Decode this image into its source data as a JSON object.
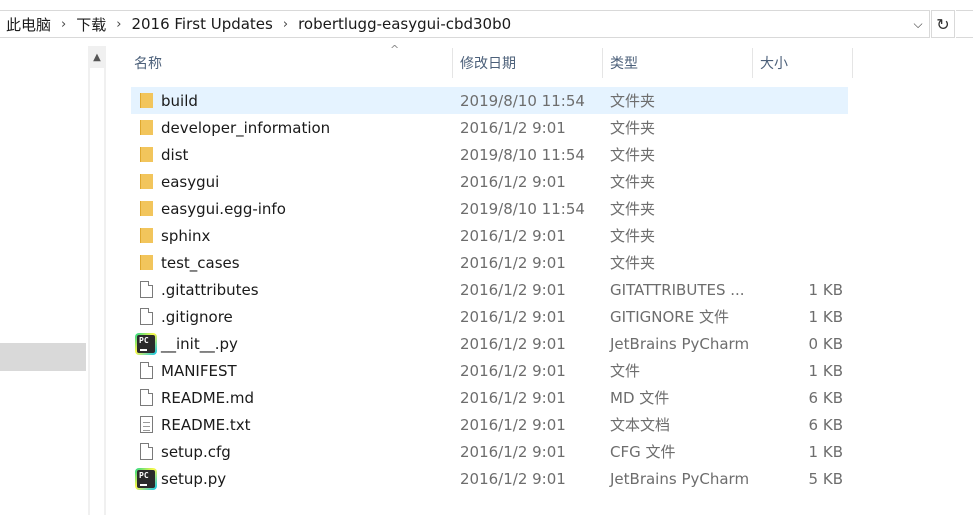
{
  "address": {
    "crumbs": [
      "此电脑",
      "下载",
      "2016 First Updates",
      "robertlugg-easygui-cbd30b0"
    ],
    "separator": "›",
    "dropdown_glyph": "⌵",
    "refresh_glyph": "↻"
  },
  "nav": {
    "scroll_up_glyph": "▲"
  },
  "columns": {
    "name": "名称",
    "date": "修改日期",
    "type": "类型",
    "size": "大小",
    "sort_glyph": "^"
  },
  "files": [
    {
      "name": "build",
      "date": "2019/8/10 11:54",
      "type": "文件夹",
      "size": "",
      "icon": "folder-icon",
      "selected": true
    },
    {
      "name": "developer_information",
      "date": "2016/1/2 9:01",
      "type": "文件夹",
      "size": "",
      "icon": "folder-icon"
    },
    {
      "name": "dist",
      "date": "2019/8/10 11:54",
      "type": "文件夹",
      "size": "",
      "icon": "folder-icon"
    },
    {
      "name": "easygui",
      "date": "2016/1/2 9:01",
      "type": "文件夹",
      "size": "",
      "icon": "folder-icon"
    },
    {
      "name": "easygui.egg-info",
      "date": "2019/8/10 11:54",
      "type": "文件夹",
      "size": "",
      "icon": "folder-icon"
    },
    {
      "name": "sphinx",
      "date": "2016/1/2 9:01",
      "type": "文件夹",
      "size": "",
      "icon": "folder-icon"
    },
    {
      "name": "test_cases",
      "date": "2016/1/2 9:01",
      "type": "文件夹",
      "size": "",
      "icon": "folder-icon"
    },
    {
      "name": ".gitattributes",
      "date": "2016/1/2 9:01",
      "type": "GITATTRIBUTES ...",
      "size": "1 KB",
      "icon": "file-icon"
    },
    {
      "name": ".gitignore",
      "date": "2016/1/2 9:01",
      "type": "GITIGNORE 文件",
      "size": "1 KB",
      "icon": "file-icon"
    },
    {
      "name": "__init__.py",
      "date": "2016/1/2 9:01",
      "type": "JetBrains PyCharm",
      "size": "0 KB",
      "icon": "pycharm-icon"
    },
    {
      "name": "MANIFEST",
      "date": "2016/1/2 9:01",
      "type": "文件",
      "size": "1 KB",
      "icon": "file-icon"
    },
    {
      "name": "README.md",
      "date": "2016/1/2 9:01",
      "type": "MD 文件",
      "size": "6 KB",
      "icon": "file-icon"
    },
    {
      "name": "README.txt",
      "date": "2016/1/2 9:01",
      "type": "文本文档",
      "size": "6 KB",
      "icon": "text-file-icon"
    },
    {
      "name": "setup.cfg",
      "date": "2016/1/2 9:01",
      "type": "CFG 文件",
      "size": "1 KB",
      "icon": "file-icon"
    },
    {
      "name": "setup.py",
      "date": "2016/1/2 9:01",
      "type": "JetBrains PyCharm",
      "size": "5 KB",
      "icon": "pycharm-icon"
    }
  ],
  "pycharm_icon_text": "PC",
  "colors": {
    "selection": "#e5f3ff",
    "header_text": "#4c607a",
    "folder": "#f2c55c"
  }
}
